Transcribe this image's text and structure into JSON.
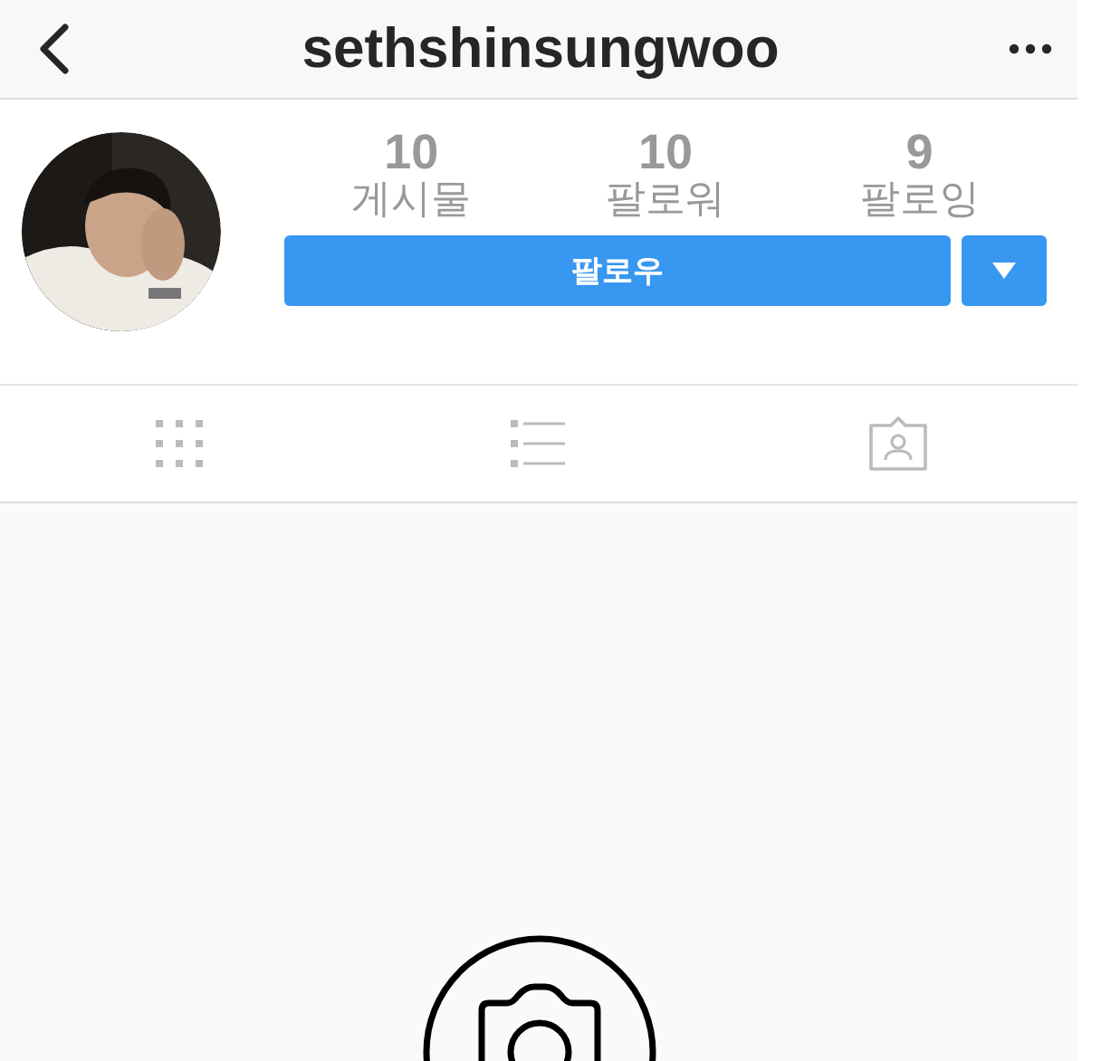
{
  "header": {
    "title": "sethshinsungwoo"
  },
  "profile": {
    "stats": [
      {
        "value": "10",
        "label": "게시물"
      },
      {
        "value": "10",
        "label": "팔로워"
      },
      {
        "value": "9",
        "label": "팔로잉"
      }
    ],
    "follow_button": {
      "label": "팔로우"
    }
  },
  "tabs": [
    {
      "kind": "grid"
    },
    {
      "kind": "list"
    },
    {
      "kind": "tagged"
    }
  ]
}
